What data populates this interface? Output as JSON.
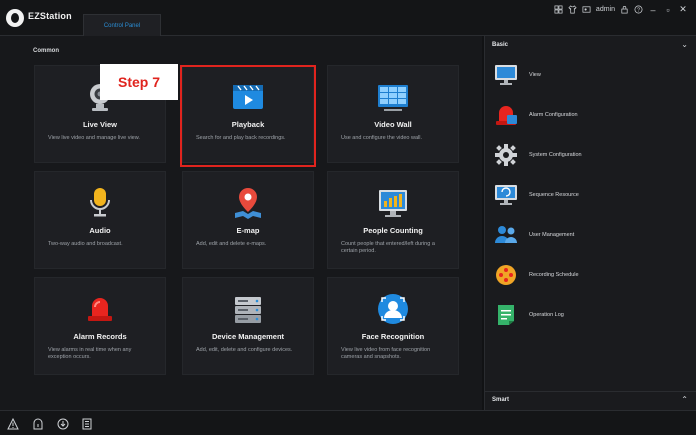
{
  "app": {
    "title": "EZStation",
    "tab": "Control Panel",
    "user": "admin"
  },
  "main": {
    "section_title": "Common",
    "tiles": [
      {
        "name": "Live View",
        "desc": "View live video and manage live view.",
        "icon": "camera-icon"
      },
      {
        "name": "Playback",
        "desc": "Search for and play back recordings.",
        "icon": "playback-icon"
      },
      {
        "name": "Video Wall",
        "desc": "Use and configure the video wall.",
        "icon": "video-wall-icon"
      },
      {
        "name": "Audio",
        "desc": "Two-way audio and broadcast.",
        "icon": "microphone-icon"
      },
      {
        "name": "E-map",
        "desc": "Add, edit and delete e-maps.",
        "icon": "map-pin-icon"
      },
      {
        "name": "People Counting",
        "desc": "Count people that entered/left during a certain period.",
        "icon": "people-counting-icon"
      },
      {
        "name": "Alarm Records",
        "desc": "View alarms in real time when any exception occurs.",
        "icon": "alarm-light-icon"
      },
      {
        "name": "Device Management",
        "desc": "Add, edit, delete and configure devices.",
        "icon": "server-icon"
      },
      {
        "name": "Face Recognition",
        "desc": "View live video from face recognition cameras and snapshots.",
        "icon": "face-icon"
      }
    ],
    "step_label": "Step 7"
  },
  "right_panel": {
    "basic_title": "Basic",
    "smart_title": "Smart",
    "items": [
      {
        "label": "View",
        "icon": "monitor-icon"
      },
      {
        "label": "Alarm Configuration",
        "icon": "alarm-config-icon"
      },
      {
        "label": "System Configuration",
        "icon": "gear-icon"
      },
      {
        "label": "Sequence Resource",
        "icon": "sequence-icon"
      },
      {
        "label": "User Management",
        "icon": "users-icon"
      },
      {
        "label": "Recording Schedule",
        "icon": "schedule-icon"
      },
      {
        "label": "Operation Log",
        "icon": "log-icon"
      }
    ]
  },
  "colors": {
    "highlight": "#e0241e",
    "accent": "#2b8ed6",
    "background": "#17181b"
  }
}
